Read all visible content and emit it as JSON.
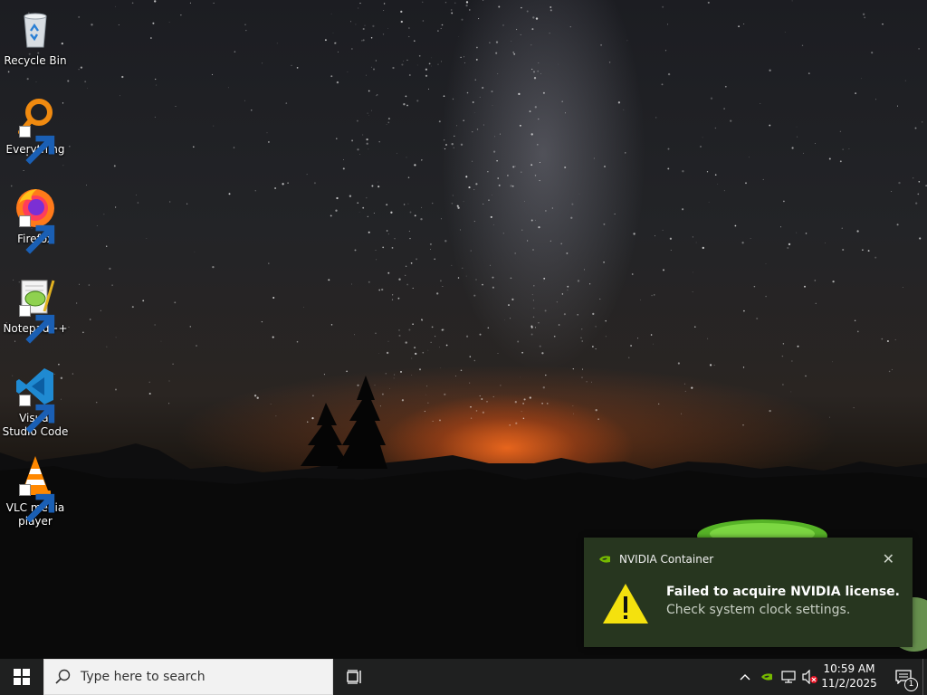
{
  "desktop": {
    "icons": [
      {
        "label": "Recycle Bin",
        "icon": "recycle-bin-icon"
      },
      {
        "label": "Everything",
        "icon": "everything-search-icon"
      },
      {
        "label": "Firefox",
        "icon": "firefox-icon"
      },
      {
        "label": "Notepad++",
        "icon": "notepad-plus-plus-icon"
      },
      {
        "label": "Visual Studio Code",
        "icon": "vscode-icon"
      },
      {
        "label": "VLC media player",
        "icon": "vlc-icon"
      }
    ]
  },
  "toast": {
    "app_name": "NVIDIA Container",
    "close_glyph": "✕",
    "title": "Failed to acquire NVIDIA license.",
    "body": "Check system clock settings.",
    "icon": "warning-icon",
    "accent": "#f4e10e",
    "background": "#27361f"
  },
  "taskbar": {
    "search_placeholder": "Type here to search",
    "time": "10:59 AM",
    "date": "11/2/2025",
    "notification_count": "1",
    "background": "#1f2020"
  }
}
